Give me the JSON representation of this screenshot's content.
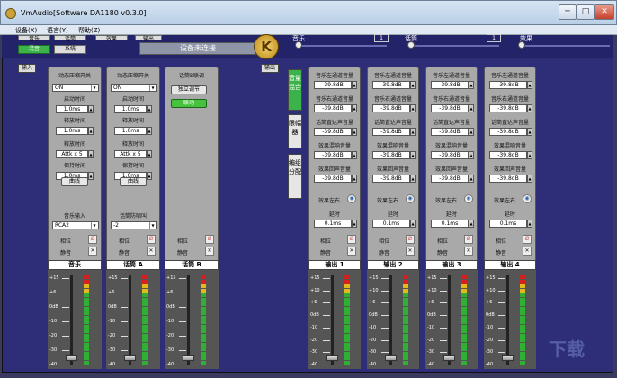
{
  "window": {
    "title": "VmAudio[Software DA1180 v0.3.0]",
    "min": "─",
    "max": "□",
    "close": "✕"
  },
  "menu": [
    "设备(X)",
    "语言(Y)",
    "帮助(Z)"
  ],
  "top": {
    "btn_left_top": "音乐",
    "btn_left_top2": "话筒",
    "btn_left_top3": "效果",
    "btn_left_top4": "输出",
    "btn_mix": "混音",
    "btn_system": "系统",
    "status": "设备未连接",
    "logo": "K",
    "music_label": "音乐",
    "music_value": "1",
    "mic_label": "话筒",
    "mic_value": "1",
    "effect_label": "效果"
  },
  "input_tag": "输入",
  "output_tag": "输出",
  "input_channels": [
    {
      "head": "动态压缩开关",
      "onoff": "ON",
      "attack_label": "启动时间",
      "attack": "1.0ms",
      "release_label": "释放时间",
      "release": "1.0ms",
      "ratio_label": "释放时间",
      "ratio": "Attk x 5",
      "hold_label": "保持时间",
      "hold": "1.0ms",
      "curve": "曲线",
      "src_label": "音乐输入",
      "src": "RCA2",
      "phase": "相位",
      "mute": "静音",
      "name": "音乐"
    },
    {
      "head": "动态压缩开关",
      "onoff": "ON",
      "attack_label": "启动时间",
      "attack": "1.0ms",
      "release_label": "释放时间",
      "release": "1.0ms",
      "ratio_label": "释放时间",
      "ratio": "Attk x 5",
      "hold_label": "保持时间",
      "hold": "1.0ms",
      "curve": "曲线",
      "src_label": "话筒防啸叫",
      "src": "-2",
      "phase": "相位",
      "mute": "静音",
      "name": "话筒 A"
    },
    {
      "head": "话筒B联调",
      "btn1": "独立调节",
      "btn2": "联动",
      "phase": "相位",
      "mute": "静音",
      "name": "话筒 B"
    }
  ],
  "side_tabs": [
    "音量混合",
    "限幅器",
    "编组分配"
  ],
  "output_channels": [
    {
      "rows": [
        [
          "音乐左通道音量",
          "-39.8dB"
        ],
        [
          "音乐右通道音量",
          "-39.8dB"
        ],
        [
          "话筒直达声音量",
          "-39.8dB"
        ],
        [
          "效果混响音量",
          "-39.8dB"
        ],
        [
          "效果回声音量",
          "-39.8dB"
        ]
      ],
      "lr": "效果左右",
      "delay_label": "延时",
      "delay": "0.1ms",
      "phase": "相位",
      "mute": "静音",
      "name": "输出 1"
    },
    {
      "rows": [
        [
          "音乐左通道音量",
          "-39.8dB"
        ],
        [
          "音乐右通道音量",
          "-39.8dB"
        ],
        [
          "话筒直达声音量",
          "-39.8dB"
        ],
        [
          "效果混响音量",
          "-39.8dB"
        ],
        [
          "效果回声音量",
          "-39.8dB"
        ]
      ],
      "lr": "效果左右",
      "delay_label": "延时",
      "delay": "0.1ms",
      "phase": "相位",
      "mute": "静音",
      "name": "输出 2"
    },
    {
      "rows": [
        [
          "音乐左通道音量",
          "-39.8dB"
        ],
        [
          "音乐右通道音量",
          "-39.8dB"
        ],
        [
          "话筒直达声音量",
          "-39.8dB"
        ],
        [
          "效果混响音量",
          "-39.8dB"
        ],
        [
          "效果回声音量",
          "-39.8dB"
        ]
      ],
      "lr": "效果左右",
      "delay_label": "延时",
      "delay": "0.1ms",
      "phase": "相位",
      "mute": "静音",
      "name": "输出 3"
    },
    {
      "rows": [
        [
          "音乐左通道音量",
          "-39.8dB"
        ],
        [
          "音乐右通道音量",
          "-39.8dB"
        ],
        [
          "话筒直达声音量",
          "-39.8dB"
        ],
        [
          "效果混响音量",
          "-39.8dB"
        ],
        [
          "效果回声音量",
          "-39.8dB"
        ]
      ],
      "lr": "效果左右",
      "delay_label": "延时",
      "delay": "0.1ms",
      "phase": "相位",
      "mute": "静音",
      "name": "输出 4"
    }
  ],
  "scale_in": [
    "+15",
    "+6",
    "0dB",
    "-10",
    "-20",
    "-30",
    "-40"
  ],
  "scale_out": [
    "+15",
    "+10",
    "+6",
    "0dB",
    "-10",
    "-20",
    "-30",
    "-40"
  ],
  "watermark": "下载"
}
